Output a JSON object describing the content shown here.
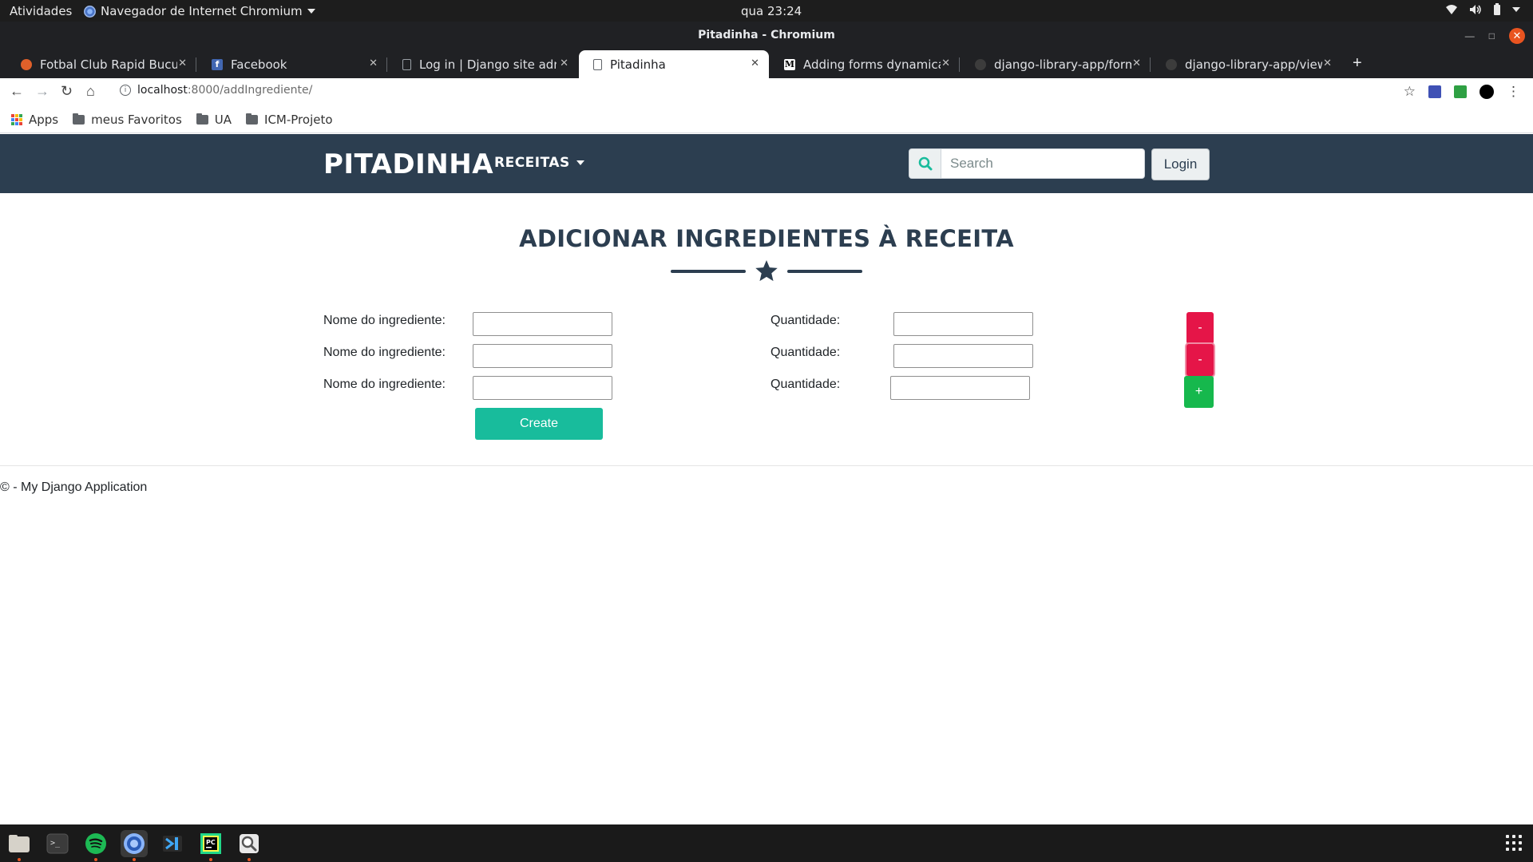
{
  "system": {
    "activities": "Atividades",
    "app_menu": "Navegador de Internet Chromium",
    "clock": "qua 23:24"
  },
  "window": {
    "title": "Pitadinha - Chromium"
  },
  "tabs": [
    {
      "label": "Fotbal Club Rapid Bucure",
      "favicon": "firefox-like-icon"
    },
    {
      "label": "Facebook",
      "favicon": "facebook-icon"
    },
    {
      "label": "Log in | Django site admin",
      "favicon": "page-icon"
    },
    {
      "label": "Pitadinha",
      "favicon": "page-icon",
      "active": true
    },
    {
      "label": "Adding forms dynamically",
      "favicon": "medium-icon"
    },
    {
      "label": "django-library-app/forms",
      "favicon": "github-icon"
    },
    {
      "label": "django-library-app/views",
      "favicon": "github-icon"
    }
  ],
  "address": {
    "host": "localhost",
    "path": ":8000/addIngrediente/"
  },
  "bookmarks": [
    "Apps",
    "meus Favoritos",
    "UA",
    "ICM-Projeto"
  ],
  "site": {
    "brand": "PITADINHA",
    "menu_label": "RECEITAS",
    "search_placeholder": "Search",
    "login_label": "Login"
  },
  "page": {
    "title": "ADICIONAR INGREDIENTES À RECEITA",
    "rows": [
      {
        "name_label": "Nome do ingrediente:",
        "qty_label": "Quantidade:",
        "name_value": "",
        "qty_value": ""
      },
      {
        "name_label": "Nome do ingrediente:",
        "qty_label": "Quantidade:",
        "name_value": "",
        "qty_value": ""
      },
      {
        "name_label": "Nome do ingrediente:",
        "qty_label": "Quantidade:",
        "name_value": "",
        "qty_value": ""
      }
    ],
    "remove_label": "-",
    "add_label": "+",
    "create_label": "Create"
  },
  "footer": {
    "text": "© - My Django Application"
  },
  "colors": {
    "navbar": "#2c3e50",
    "primary_teal": "#18bc9c",
    "remove_red": "#e51548",
    "add_green": "#16b84d"
  }
}
